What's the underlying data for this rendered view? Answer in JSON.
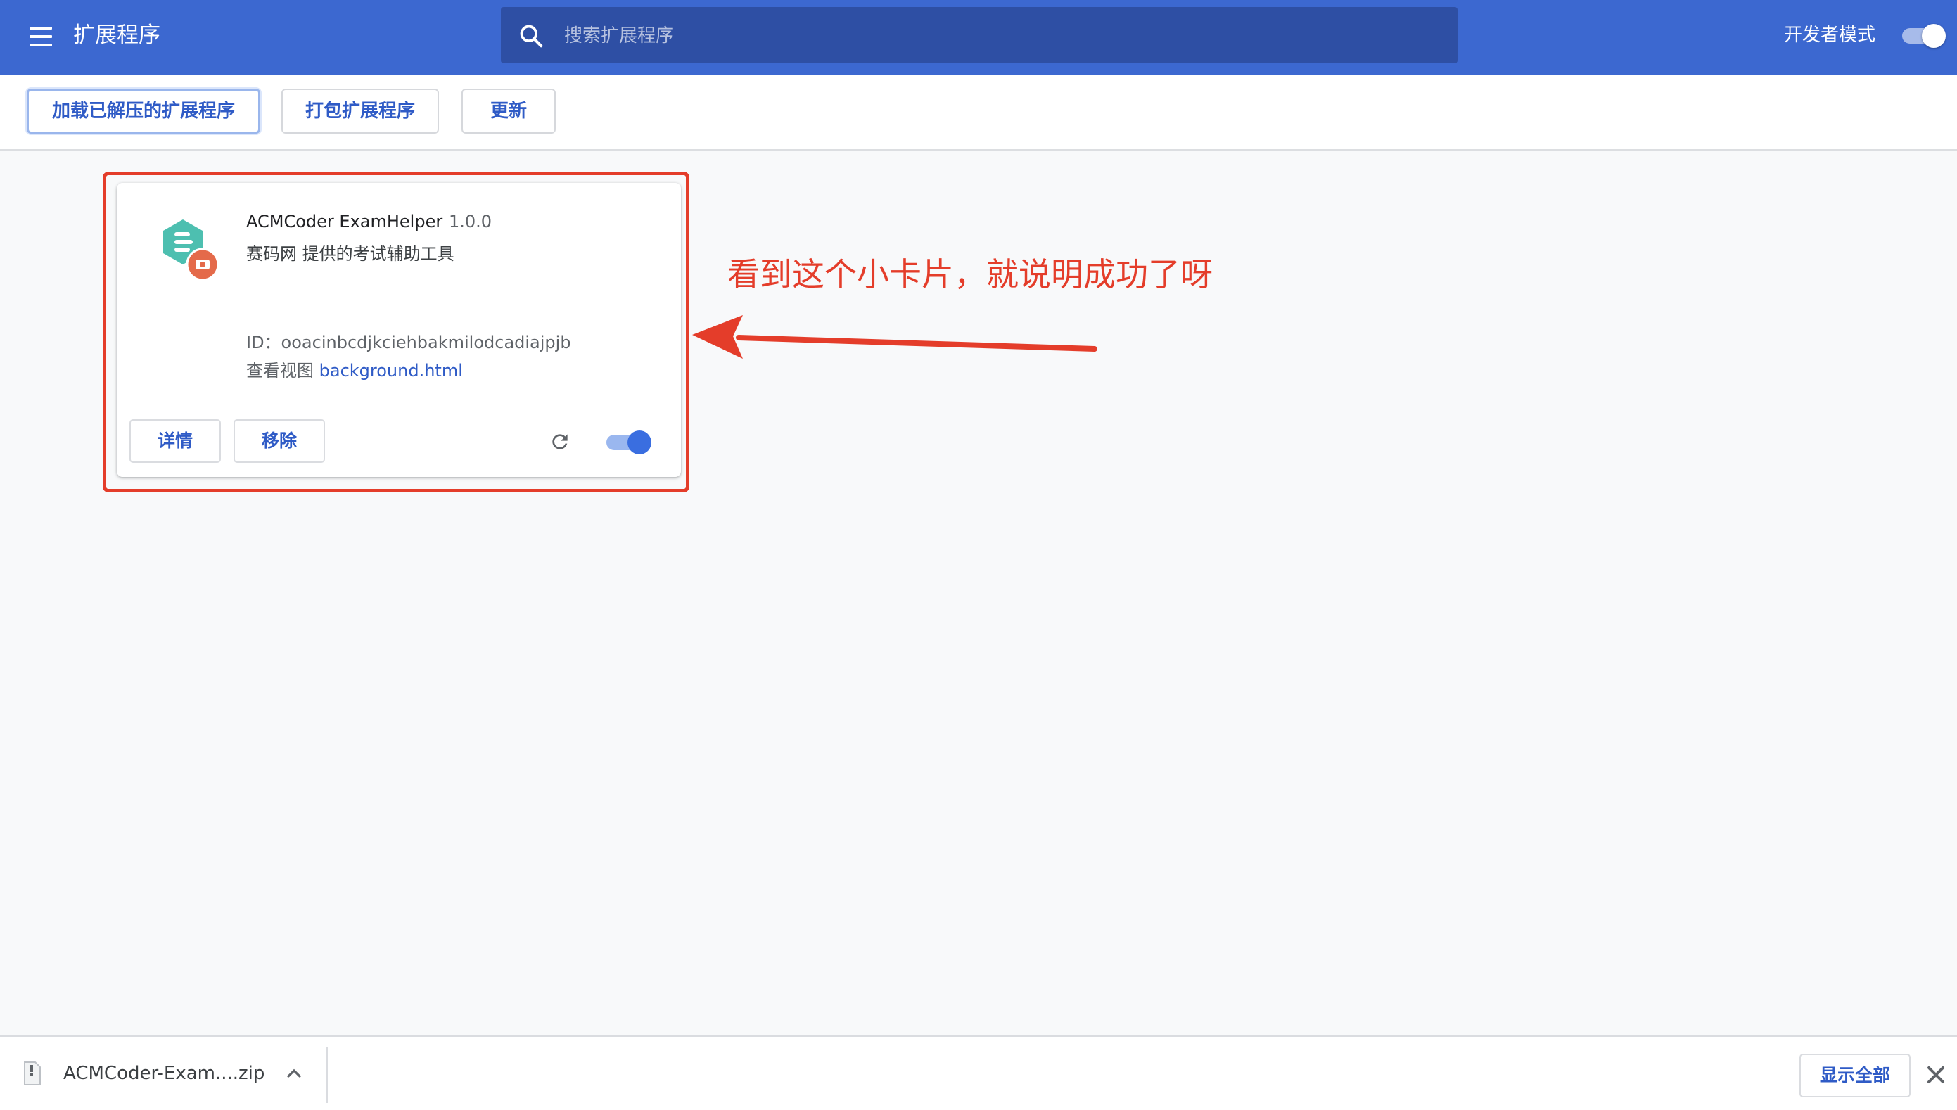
{
  "header": {
    "title": "扩展程序",
    "menu_icon": "hamburger-menu-icon",
    "search": {
      "placeholder": "搜索扩展程序",
      "icon": "search-icon"
    },
    "developer_mode": {
      "label": "开发者模式",
      "enabled": true
    }
  },
  "toolbar": {
    "load_unpacked": "加载已解压的扩展程序",
    "pack_extension": "打包扩展程序",
    "update": "更新"
  },
  "extension": {
    "name": "ACMCoder ExamHelper",
    "version": "1.0.0",
    "description": "赛码网 提供的考试辅助工具",
    "id_text": "ID：ooacinbcdjkciehbakmilodcadiajpjb",
    "views_label": "查看视图",
    "views_link": "background.html",
    "details_button": "详情",
    "remove_button": "移除",
    "enabled": true
  },
  "annotation": {
    "text": "看到这个小卡片，就说明成功了呀",
    "color": "#e43d2a"
  },
  "download_bar": {
    "filename": "ACMCoder-Exam....zip",
    "show_all": "显示全部"
  },
  "colors": {
    "header_bg": "#3c68d0",
    "accent": "#2f5bc6",
    "annotation_red": "#e43d2a"
  }
}
